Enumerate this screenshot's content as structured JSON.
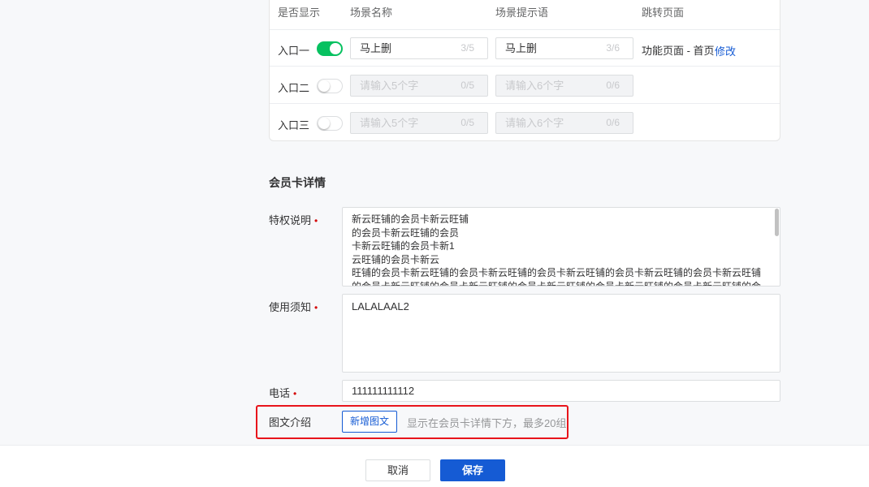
{
  "table": {
    "headers": {
      "show": "是否显示",
      "name": "场景名称",
      "tip": "场景提示语",
      "jump": "跳转页面"
    },
    "rows": [
      {
        "label": "入口一",
        "enabled": true,
        "name_value": "马上删",
        "name_count": "3/5",
        "tip_value": "马上删",
        "tip_count": "3/6",
        "jump_page": "功能页面 - 首页",
        "edit_label": "修改"
      },
      {
        "label": "入口二",
        "enabled": false,
        "name_placeholder": "请输入5个字",
        "name_count": "0/5",
        "tip_placeholder": "请输入6个字",
        "tip_count": "0/6"
      },
      {
        "label": "入口三",
        "enabled": false,
        "name_placeholder": "请输入5个字",
        "name_count": "0/5",
        "tip_placeholder": "请输入6个字",
        "tip_count": "0/6"
      }
    ]
  },
  "detail": {
    "title": "会员卡详情",
    "required_mark": "•",
    "privilege_label": "特权说明",
    "privilege_lines": [
      "新云旺铺的会员卡新云旺铺",
      "的会员卡新云旺铺的会员",
      "卡新云旺铺的会员卡新1",
      "云旺铺的会员卡新云",
      "旺铺的会员卡新云旺铺的会员卡新云旺铺的会员卡新云旺铺的会员卡新云旺铺的会员卡新云旺铺",
      "的会员卡新云旺铺的会员卡新云旺铺的会员卡新云旺铺的会员卡新云旺铺的会员卡新云旺铺的会"
    ],
    "notice_label": "使用须知",
    "notice_value": "LALALAAL2",
    "phone_label": "电话",
    "phone_value": "111111111112",
    "rich_label": "图文介绍",
    "rich_button": "新增图文",
    "rich_hint": "显示在会员卡详情下方，最多20组"
  },
  "footer": {
    "cancel": "取消",
    "save": "保存"
  },
  "colors": {
    "primary": "#155bd4",
    "switch_on": "#07c160",
    "required": "#d40000",
    "highlight": "#e8141b"
  }
}
